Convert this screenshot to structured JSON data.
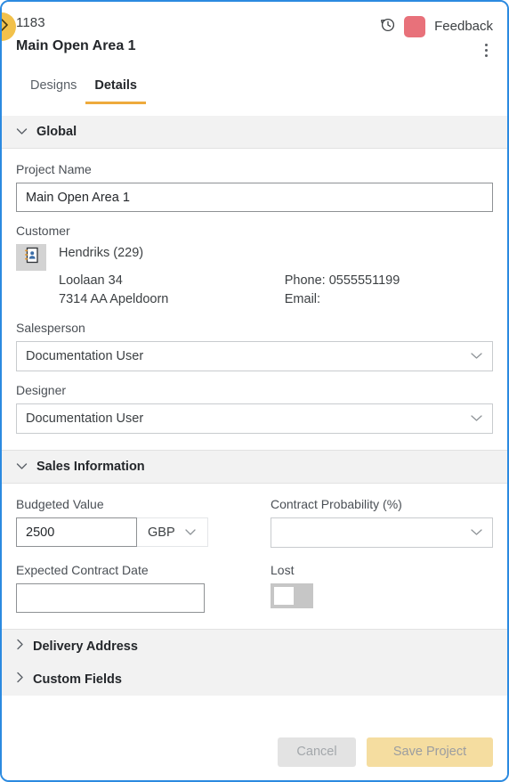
{
  "header": {
    "project_id": "1183",
    "project_title": "Main Open Area 1",
    "history_icon": "history-clock-icon",
    "color_swatch": "#e8717a",
    "feedback_label": "Feedback",
    "more_icon": "kebab-menu-icon",
    "edge_toggle_icon": "chevron-right-icon"
  },
  "tabs": [
    {
      "label": "Designs",
      "active": false
    },
    {
      "label": "Details",
      "active": true
    }
  ],
  "sections": {
    "global": {
      "title": "Global",
      "expanded": true,
      "chevron": "chevron-down-icon",
      "project_name": {
        "label": "Project Name",
        "value": "Main Open Area 1",
        "placeholder": ""
      },
      "customer": {
        "label": "Customer",
        "picker_icon": "address-book-icon",
        "name": "Hendriks (229)",
        "address_line1": "Loolaan 34",
        "address_line2": "7314 AA Apeldoorn",
        "phone": "Phone: 0555551199",
        "email": "Email:"
      },
      "salesperson": {
        "label": "Salesperson",
        "value": "Documentation User",
        "chevron": "chevron-down-icon"
      },
      "designer": {
        "label": "Designer",
        "value": "Documentation User",
        "chevron": "chevron-down-icon"
      }
    },
    "sales_information": {
      "title": "Sales Information",
      "expanded": true,
      "chevron": "chevron-down-icon",
      "budgeted_value": {
        "label": "Budgeted Value",
        "value": "2500",
        "currency": "GBP",
        "currency_chevron": "chevron-down-icon"
      },
      "contract_probability": {
        "label": "Contract Probability (%)",
        "value": "",
        "chevron": "chevron-down-icon"
      },
      "expected_contract_date": {
        "label": "Expected Contract Date",
        "value": "",
        "placeholder": ""
      },
      "lost": {
        "label": "Lost",
        "state": "off"
      }
    },
    "delivery_address": {
      "title": "Delivery Address",
      "expanded": false,
      "chevron": "chevron-right-icon"
    },
    "custom_fields": {
      "title": "Custom Fields",
      "expanded": false,
      "chevron": "chevron-right-icon"
    }
  },
  "footer": {
    "cancel_label": "Cancel",
    "save_label": "Save Project"
  },
  "colors": {
    "accent_amber": "#eeaa3c",
    "save_button": "#f5dda0",
    "swatch_red": "#e8717a",
    "window_border": "#2b8ae0",
    "section_header_bg": "#f2f2f2"
  }
}
